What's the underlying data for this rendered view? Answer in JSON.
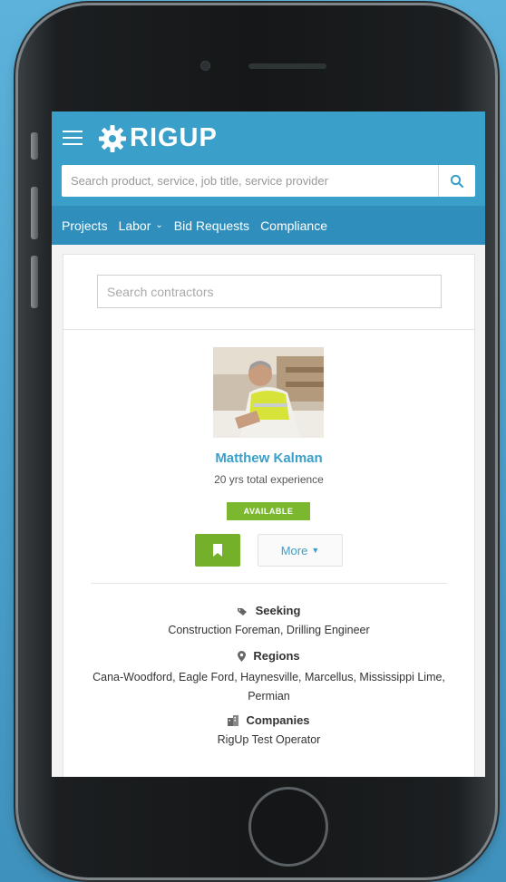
{
  "app": {
    "logo_text": "RIGUP",
    "menu_icon": "hamburger-menu-icon",
    "logo_icon": "gear-logo-icon"
  },
  "global_search": {
    "placeholder": "Search product, service, job title, service provider",
    "button_icon": "search-icon"
  },
  "nav": {
    "items": [
      {
        "label": "Projects"
      },
      {
        "label": "Labor",
        "has_dropdown": true
      },
      {
        "label": "Bid Requests"
      },
      {
        "label": "Compliance"
      }
    ]
  },
  "contractor_search": {
    "placeholder": "Search contractors"
  },
  "profile": {
    "name": "Matthew Kalman",
    "experience": "20 yrs total experience",
    "status_badge": "AVAILABLE",
    "bookmark_icon": "bookmark-icon",
    "more_label": "More",
    "seeking": {
      "title": "Seeking",
      "text": "Construction Foreman, Drilling Engineer"
    },
    "regions": {
      "title": "Regions",
      "text": "Cana-Woodford, Eagle Ford, Haynesville, Marcellus, Mississippi Lime, Permian"
    },
    "companies": {
      "title": "Companies",
      "text": "RigUp Test Operator"
    }
  },
  "colors": {
    "brand_blue": "#3a9fc9",
    "nav_blue": "#2f8ebc",
    "available_green": "#7cb82f",
    "background": "#4ba3cf"
  }
}
